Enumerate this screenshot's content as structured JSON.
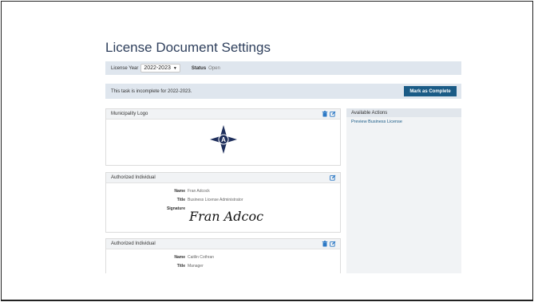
{
  "page": {
    "title": "License Document Settings"
  },
  "filters": {
    "license_year_label": "License Year",
    "license_year_value": "2022-2023",
    "status_label": "Status",
    "status_value": "Open"
  },
  "banner": {
    "message": "This task is incomplete for 2022-2023.",
    "button_label": "Mark as Complete"
  },
  "logo_card": {
    "title": "Municipality Logo",
    "logo_letter": "A"
  },
  "authorized_1": {
    "title": "Authorized Individual",
    "name_label": "Name",
    "name_value": "Fran Adcock",
    "title_label": "Title",
    "title_value": "Business License Administrator",
    "signature_label": "Signature",
    "signature_text": "Fran Adcock"
  },
  "authorized_2": {
    "title": "Authorized Individual",
    "name_label": "Name",
    "name_value": "Caitlin Cothran",
    "title_label": "Title",
    "title_value": "Manager"
  },
  "actions": {
    "title": "Available Actions",
    "items": [
      "Preview Business License"
    ]
  },
  "colors": {
    "primary_button": "#1a5b86",
    "band_bg": "#dfe6ee",
    "icon_blue": "#2b78c5",
    "logo_navy": "#1f2f5c"
  }
}
